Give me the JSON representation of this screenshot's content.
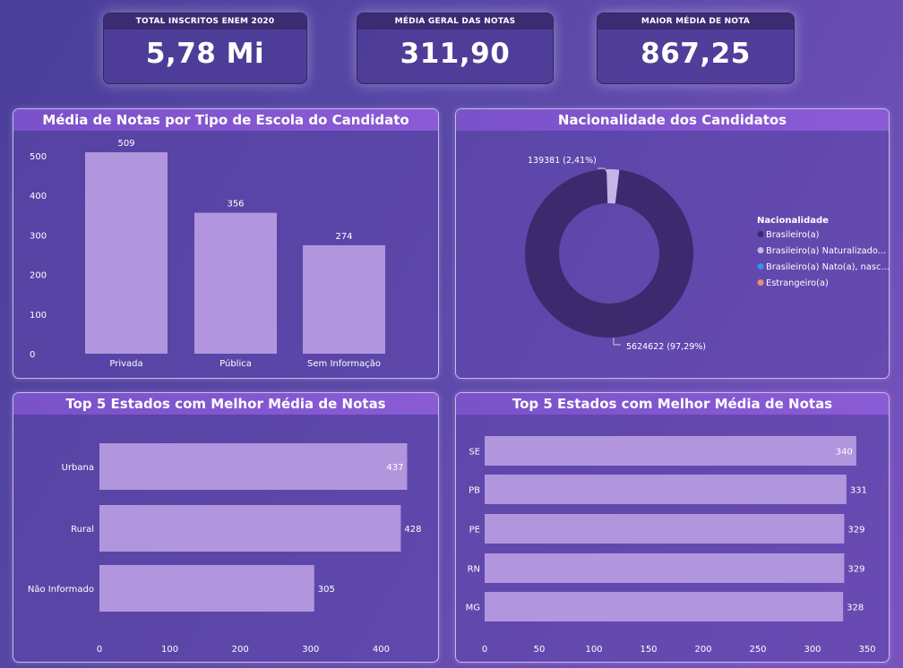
{
  "kpis": [
    {
      "label": "TOTAL INSCRITOS ENEM 2020",
      "value": "5,78 Mi"
    },
    {
      "label": "MÉDIA GERAL DAS NOTAS",
      "value": "311,90"
    },
    {
      "label": "MAIOR MÉDIA DE NOTA",
      "value": "867,25"
    }
  ],
  "colors": {
    "bar": "#b196de",
    "donut_main": "#3d2a6e",
    "donut_minor": "#c4b5e8",
    "legend_blue": "#3a8df5",
    "legend_salmon": "#f08a7a"
  },
  "chart_data": [
    {
      "type": "bar",
      "title": "Média de Notas por Tipo de Escola do Candidato",
      "categories": [
        "Privada",
        "Pública",
        "Sem Informação"
      ],
      "values": [
        509,
        356,
        274
      ],
      "value_labels": [
        "509",
        "356",
        "274"
      ],
      "yticks": [
        "0",
        "100",
        "200",
        "300",
        "400",
        "500"
      ],
      "ylim": [
        0,
        520
      ]
    },
    {
      "type": "pie",
      "title": "Nacionalidade dos Candidatos",
      "legend_title": "Nacionalidade",
      "legend": [
        "Brasileiro(a)",
        "Brasileiro(a) Naturalizado...",
        "Brasileiro(a) Nato(a), nasc...",
        "Estrangeiro(a)"
      ],
      "values": [
        5624622,
        139381
      ],
      "labels": [
        "5624622 (97,29%)",
        "139381 (2,41%)"
      ]
    },
    {
      "type": "bar",
      "orientation": "horizontal",
      "title": "Top 5 Estados com Melhor Média de Notas",
      "categories": [
        "Urbana",
        "Rural",
        "Não Informado"
      ],
      "values": [
        437,
        428,
        305
      ],
      "value_labels": [
        "437",
        "428",
        "305"
      ],
      "xticks": [
        "0",
        "100",
        "200",
        "300",
        "400"
      ],
      "xlim": [
        0,
        460
      ]
    },
    {
      "type": "bar",
      "orientation": "horizontal",
      "title": "Top 5 Estados com Melhor Média de Notas",
      "categories": [
        "SE",
        "PB",
        "PE",
        "RN",
        "MG"
      ],
      "values": [
        340,
        331,
        329,
        329,
        328
      ],
      "value_labels": [
        "340",
        "331",
        "329",
        "329",
        "328"
      ],
      "xticks": [
        "0",
        "50",
        "100",
        "150",
        "200",
        "250",
        "300",
        "350"
      ],
      "xlim": [
        0,
        350
      ]
    }
  ]
}
